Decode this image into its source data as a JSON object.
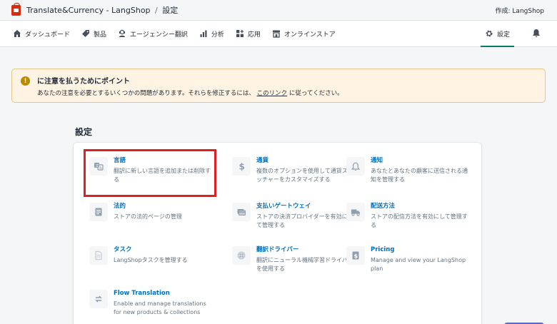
{
  "header": {
    "app_title": "Translate&Currency - LangShop",
    "separator": "/",
    "current_page": "設定",
    "author": "作成: LangShop"
  },
  "nav": {
    "items": [
      {
        "label": "ダッシュボード",
        "icon": "home-icon"
      },
      {
        "label": "製品",
        "icon": "tag-icon"
      },
      {
        "label": "エージェンシー翻訳",
        "icon": "agent-icon"
      },
      {
        "label": "分析",
        "icon": "bar-chart-icon"
      },
      {
        "label": "応用",
        "icon": "apps-icon"
      },
      {
        "label": "オンラインストア",
        "icon": "store-icon"
      }
    ],
    "settings_label": "設定",
    "settings_icon": "gear-icon",
    "bell_icon": "bell-icon"
  },
  "banner": {
    "title": "に注意を払うためにポイント",
    "text_before": "あなたの注意を必要とするいくつかの問題があります。それらを修正するには、",
    "link_text": "このリンク",
    "text_after": "に従ってください。"
  },
  "settings": {
    "title": "設定",
    "items": [
      {
        "name": "言語",
        "desc": "翻訳に新しい言語を追加または削除する",
        "icon": "translate-icon"
      },
      {
        "name": "通貨",
        "desc": "複数のオプションを使用して通貨スイッチャーをカスタマイズする",
        "icon": "dollar-icon"
      },
      {
        "name": "通知",
        "desc": "あなたとあなたの顧客に送信される通知を管理する",
        "icon": "bell-icon"
      },
      {
        "name": "法的",
        "desc": "ストアの法的ページの管理",
        "icon": "legal-icon"
      },
      {
        "name": "支払いゲートウェイ",
        "desc": "ストアの決済プロバイダーを有効にして管理する",
        "icon": "payment-icon"
      },
      {
        "name": "配送方法",
        "desc": "ストアの配信方法を有効にして管理する",
        "icon": "truck-icon"
      },
      {
        "name": "タスク",
        "desc": "LangShopタスクを管理する",
        "icon": "task-icon"
      },
      {
        "name": "翻訳ドライバー",
        "desc": "翻訳にニューラル機械学習ドライバーを使用する",
        "icon": "driver-icon"
      },
      {
        "name": "Pricing",
        "desc": "Manage and view your LangShop plan",
        "icon": "pricing-icon"
      },
      {
        "name": "Flow Translation",
        "desc": "Enable and manage translations for new products & collections",
        "icon": "flow-icon"
      }
    ]
  }
}
